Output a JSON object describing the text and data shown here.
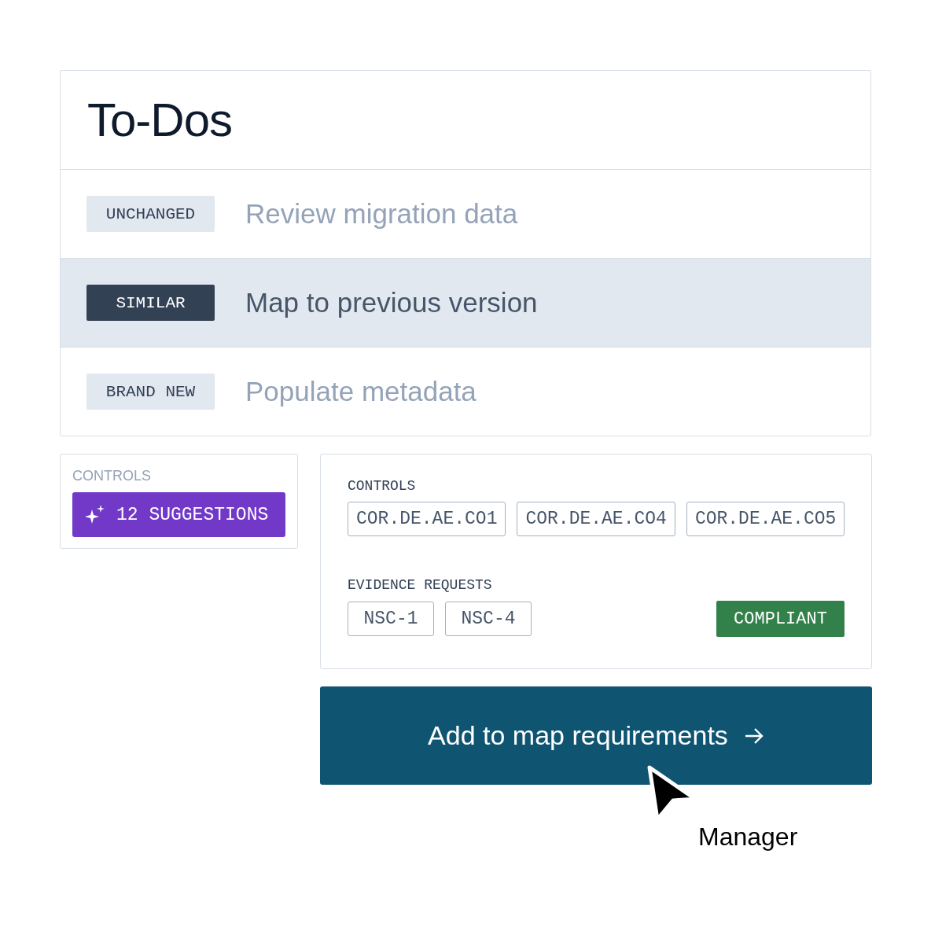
{
  "todos": {
    "title": "To-Dos",
    "items": [
      {
        "tag": "UNCHANGED",
        "label": "Review migration data",
        "selected": false
      },
      {
        "tag": "SIMILAR",
        "label": "Map to previous version",
        "selected": true
      },
      {
        "tag": "BRAND NEW",
        "label": "Populate metadata",
        "selected": false
      }
    ]
  },
  "suggestions_card": {
    "heading": "CONTROLS",
    "button": "12 SUGGESTIONS"
  },
  "detail_card": {
    "controls_heading": "CONTROLS",
    "controls": [
      "COR.DE.AE.CO1",
      "COR.DE.AE.CO4",
      "COR.DE.AE.CO5"
    ],
    "evidence_heading": "EVIDENCE REQUESTS",
    "evidence": [
      "NSC-1",
      "NSC-4"
    ],
    "status": "COMPLIANT"
  },
  "action_button": "Add to map requirements",
  "cursor_label": "Manager"
}
